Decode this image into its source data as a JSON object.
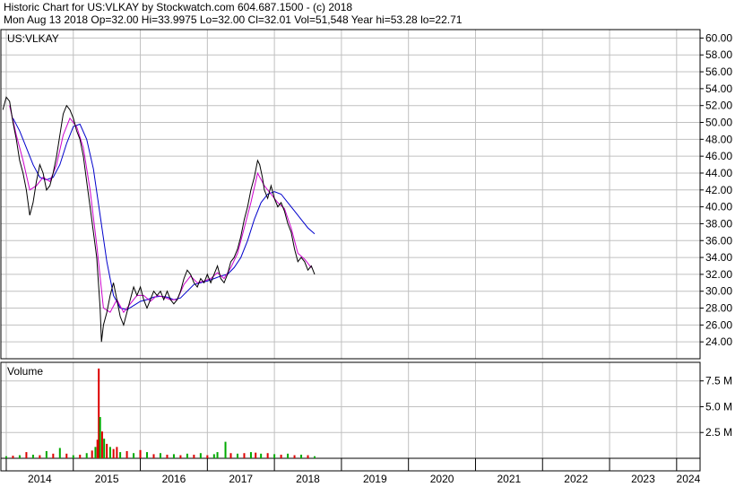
{
  "header": {
    "line1": "Historic Chart for US:VLKAY by Stockwatch.com 604.687.1500 - (c) 2018",
    "line2": "Mon Aug 13 2018  Op=32.00  Hi=33.9975  Lo=32.00  Cl=32.01  Vol=51,548  Year hi=53.28  lo=22.71"
  },
  "colors": {
    "price": "#000000",
    "ma_short": "#cc00cc",
    "ma_long": "#0000cc",
    "vol_up": "#00aa00",
    "vol_down": "#dd0000",
    "grid": "#c0c0c0"
  },
  "chart_data": [
    {
      "type": "line",
      "label": "US:VLKAY",
      "ylim": [
        22.0,
        61.0
      ],
      "y_ticks": [
        "60.00",
        "58.00",
        "56.00",
        "54.00",
        "52.00",
        "50.00",
        "48.00",
        "46.00",
        "44.00",
        "42.00",
        "40.00",
        "38.00",
        "36.00",
        "34.00",
        "32.00",
        "30.00",
        "28.00",
        "26.00",
        "24.00"
      ],
      "x_ticks": [
        "2014",
        "2015",
        "2016",
        "2017",
        "2018",
        "2019",
        "2020",
        "2021",
        "2022",
        "2023",
        "2024"
      ],
      "x_domain": [
        2013.92,
        2024.35
      ],
      "price_points": [
        [
          2013.95,
          51.5
        ],
        [
          2014.0,
          53.0
        ],
        [
          2014.05,
          52.5
        ],
        [
          2014.1,
          50.0
        ],
        [
          2014.15,
          48.0
        ],
        [
          2014.2,
          45.5
        ],
        [
          2014.25,
          44.0
        ],
        [
          2014.3,
          42.0
        ],
        [
          2014.35,
          39.0
        ],
        [
          2014.4,
          40.5
        ],
        [
          2014.45,
          43.0
        ],
        [
          2014.5,
          45.0
        ],
        [
          2014.55,
          44.0
        ],
        [
          2014.6,
          42.0
        ],
        [
          2014.65,
          42.5
        ],
        [
          2014.7,
          44.0
        ],
        [
          2014.75,
          46.0
        ],
        [
          2014.8,
          48.5
        ],
        [
          2014.85,
          51.0
        ],
        [
          2014.9,
          52.0
        ],
        [
          2014.95,
          51.5
        ],
        [
          2015.0,
          50.5
        ],
        [
          2015.05,
          49.0
        ],
        [
          2015.1,
          48.0
        ],
        [
          2015.15,
          46.0
        ],
        [
          2015.2,
          43.0
        ],
        [
          2015.25,
          40.0
        ],
        [
          2015.3,
          37.0
        ],
        [
          2015.35,
          34.0
        ],
        [
          2015.4,
          28.0
        ],
        [
          2015.42,
          24.0
        ],
        [
          2015.45,
          26.0
        ],
        [
          2015.5,
          27.5
        ],
        [
          2015.55,
          29.5
        ],
        [
          2015.6,
          31.0
        ],
        [
          2015.65,
          29.0
        ],
        [
          2015.7,
          27.0
        ],
        [
          2015.75,
          26.0
        ],
        [
          2015.8,
          27.5
        ],
        [
          2015.85,
          29.0
        ],
        [
          2015.9,
          30.5
        ],
        [
          2015.95,
          29.5
        ],
        [
          2016.0,
          30.5
        ],
        [
          2016.05,
          29.0
        ],
        [
          2016.1,
          28.0
        ],
        [
          2016.15,
          29.0
        ],
        [
          2016.2,
          30.0
        ],
        [
          2016.25,
          29.5
        ],
        [
          2016.3,
          30.0
        ],
        [
          2016.35,
          29.0
        ],
        [
          2016.4,
          30.0
        ],
        [
          2016.45,
          29.0
        ],
        [
          2016.5,
          28.5
        ],
        [
          2016.55,
          29.0
        ],
        [
          2016.6,
          30.0
        ],
        [
          2016.65,
          31.5
        ],
        [
          2016.7,
          32.5
        ],
        [
          2016.75,
          32.0
        ],
        [
          2016.8,
          31.0
        ],
        [
          2016.85,
          30.5
        ],
        [
          2016.9,
          31.5
        ],
        [
          2016.95,
          31.0
        ],
        [
          2017.0,
          32.0
        ],
        [
          2017.05,
          31.0
        ],
        [
          2017.1,
          32.0
        ],
        [
          2017.15,
          33.0
        ],
        [
          2017.2,
          31.5
        ],
        [
          2017.25,
          31.0
        ],
        [
          2017.3,
          32.0
        ],
        [
          2017.35,
          33.5
        ],
        [
          2017.4,
          34.0
        ],
        [
          2017.45,
          35.0
        ],
        [
          2017.5,
          36.5
        ],
        [
          2017.55,
          38.5
        ],
        [
          2017.6,
          40.0
        ],
        [
          2017.65,
          42.0
        ],
        [
          2017.7,
          43.5
        ],
        [
          2017.75,
          45.5
        ],
        [
          2017.78,
          45.0
        ],
        [
          2017.82,
          43.5
        ],
        [
          2017.85,
          42.0
        ],
        [
          2017.9,
          41.0
        ],
        [
          2017.95,
          42.5
        ],
        [
          2018.0,
          41.0
        ],
        [
          2018.05,
          40.0
        ],
        [
          2018.1,
          40.5
        ],
        [
          2018.15,
          39.5
        ],
        [
          2018.2,
          38.0
        ],
        [
          2018.25,
          37.0
        ],
        [
          2018.3,
          35.0
        ],
        [
          2018.35,
          33.5
        ],
        [
          2018.4,
          34.0
        ],
        [
          2018.45,
          33.5
        ],
        [
          2018.5,
          32.5
        ],
        [
          2018.55,
          33.0
        ],
        [
          2018.6,
          32.0
        ]
      ],
      "ma_short_points": [
        [
          2014.05,
          52.0
        ],
        [
          2014.15,
          48.5
        ],
        [
          2014.25,
          45.5
        ],
        [
          2014.35,
          42.0
        ],
        [
          2014.45,
          42.5
        ],
        [
          2014.55,
          43.5
        ],
        [
          2014.65,
          43.0
        ],
        [
          2014.75,
          45.0
        ],
        [
          2014.85,
          48.5
        ],
        [
          2014.95,
          50.5
        ],
        [
          2015.05,
          49.5
        ],
        [
          2015.15,
          47.0
        ],
        [
          2015.25,
          42.0
        ],
        [
          2015.35,
          35.5
        ],
        [
          2015.45,
          28.0
        ],
        [
          2015.55,
          27.5
        ],
        [
          2015.65,
          29.0
        ],
        [
          2015.75,
          27.5
        ],
        [
          2015.85,
          28.5
        ],
        [
          2015.95,
          29.5
        ],
        [
          2016.05,
          29.5
        ],
        [
          2016.15,
          28.8
        ],
        [
          2016.25,
          29.5
        ],
        [
          2016.35,
          29.3
        ],
        [
          2016.45,
          29.0
        ],
        [
          2016.55,
          29.0
        ],
        [
          2016.65,
          30.8
        ],
        [
          2016.75,
          31.8
        ],
        [
          2016.85,
          31.0
        ],
        [
          2016.95,
          31.2
        ],
        [
          2017.05,
          31.5
        ],
        [
          2017.15,
          32.2
        ],
        [
          2017.25,
          31.5
        ],
        [
          2017.35,
          32.8
        ],
        [
          2017.45,
          34.5
        ],
        [
          2017.55,
          37.5
        ],
        [
          2017.65,
          40.5
        ],
        [
          2017.75,
          44.0
        ],
        [
          2017.85,
          42.5
        ],
        [
          2017.95,
          41.5
        ],
        [
          2018.05,
          40.5
        ],
        [
          2018.15,
          39.8
        ],
        [
          2018.25,
          37.5
        ],
        [
          2018.35,
          34.5
        ],
        [
          2018.45,
          33.8
        ],
        [
          2018.55,
          32.8
        ]
      ],
      "ma_long_points": [
        [
          2014.1,
          50.5
        ],
        [
          2014.2,
          49.0
        ],
        [
          2014.3,
          47.0
        ],
        [
          2014.4,
          45.0
        ],
        [
          2014.5,
          43.5
        ],
        [
          2014.6,
          43.2
        ],
        [
          2014.7,
          43.5
        ],
        [
          2014.8,
          45.0
        ],
        [
          2014.9,
          47.5
        ],
        [
          2015.0,
          49.5
        ],
        [
          2015.1,
          49.8
        ],
        [
          2015.2,
          48.0
        ],
        [
          2015.3,
          44.5
        ],
        [
          2015.4,
          39.0
        ],
        [
          2015.5,
          33.5
        ],
        [
          2015.6,
          29.5
        ],
        [
          2015.7,
          28.0
        ],
        [
          2015.8,
          27.8
        ],
        [
          2015.9,
          28.3
        ],
        [
          2016.0,
          28.8
        ],
        [
          2016.1,
          29.0
        ],
        [
          2016.2,
          29.3
        ],
        [
          2016.3,
          29.4
        ],
        [
          2016.4,
          29.3
        ],
        [
          2016.5,
          29.0
        ],
        [
          2016.6,
          29.2
        ],
        [
          2016.7,
          30.0
        ],
        [
          2016.8,
          30.8
        ],
        [
          2016.9,
          31.0
        ],
        [
          2017.0,
          31.2
        ],
        [
          2017.1,
          31.5
        ],
        [
          2017.2,
          31.8
        ],
        [
          2017.3,
          32.0
        ],
        [
          2017.4,
          32.8
        ],
        [
          2017.5,
          34.0
        ],
        [
          2017.6,
          36.0
        ],
        [
          2017.7,
          38.5
        ],
        [
          2017.8,
          40.5
        ],
        [
          2017.9,
          41.5
        ],
        [
          2018.0,
          41.8
        ],
        [
          2018.1,
          41.5
        ],
        [
          2018.2,
          40.5
        ],
        [
          2018.3,
          39.5
        ],
        [
          2018.4,
          38.5
        ],
        [
          2018.5,
          37.5
        ],
        [
          2018.6,
          36.8
        ]
      ]
    },
    {
      "type": "bar",
      "label": "Volume",
      "ylim": [
        0,
        9.3
      ],
      "y_ticks": [
        "7.5 M",
        "5.0 M",
        "2.5 M"
      ],
      "bars": [
        [
          2014.0,
          0.2,
          "up"
        ],
        [
          2014.1,
          0.25,
          "down"
        ],
        [
          2014.2,
          0.3,
          "up"
        ],
        [
          2014.3,
          0.6,
          "down"
        ],
        [
          2014.4,
          0.35,
          "up"
        ],
        [
          2014.5,
          0.3,
          "down"
        ],
        [
          2014.6,
          0.7,
          "up"
        ],
        [
          2014.7,
          0.45,
          "down"
        ],
        [
          2014.8,
          1.0,
          "up"
        ],
        [
          2014.9,
          0.45,
          "down"
        ],
        [
          2015.0,
          0.3,
          "up"
        ],
        [
          2015.1,
          0.35,
          "down"
        ],
        [
          2015.2,
          0.5,
          "up"
        ],
        [
          2015.28,
          0.75,
          "down"
        ],
        [
          2015.33,
          1.1,
          "up"
        ],
        [
          2015.36,
          1.8,
          "down"
        ],
        [
          2015.38,
          8.7,
          "down"
        ],
        [
          2015.4,
          4.0,
          "up"
        ],
        [
          2015.43,
          2.6,
          "down"
        ],
        [
          2015.46,
          1.9,
          "up"
        ],
        [
          2015.5,
          1.4,
          "down"
        ],
        [
          2015.55,
          1.1,
          "up"
        ],
        [
          2015.6,
          0.9,
          "down"
        ],
        [
          2015.65,
          1.1,
          "down"
        ],
        [
          2015.7,
          0.6,
          "up"
        ],
        [
          2015.8,
          0.7,
          "down"
        ],
        [
          2015.9,
          0.5,
          "up"
        ],
        [
          2016.0,
          0.8,
          "down"
        ],
        [
          2016.1,
          0.6,
          "up"
        ],
        [
          2016.2,
          0.4,
          "down"
        ],
        [
          2016.3,
          0.5,
          "up"
        ],
        [
          2016.4,
          0.35,
          "down"
        ],
        [
          2016.5,
          0.4,
          "up"
        ],
        [
          2016.6,
          0.3,
          "down"
        ],
        [
          2016.7,
          0.45,
          "up"
        ],
        [
          2016.8,
          0.35,
          "down"
        ],
        [
          2016.9,
          0.5,
          "up"
        ],
        [
          2017.0,
          0.3,
          "down"
        ],
        [
          2017.1,
          0.4,
          "up"
        ],
        [
          2017.15,
          0.6,
          "up"
        ],
        [
          2017.27,
          1.6,
          "up"
        ],
        [
          2017.35,
          0.5,
          "down"
        ],
        [
          2017.45,
          0.45,
          "up"
        ],
        [
          2017.55,
          0.5,
          "down"
        ],
        [
          2017.65,
          0.6,
          "up"
        ],
        [
          2017.72,
          0.55,
          "down"
        ],
        [
          2017.8,
          0.45,
          "up"
        ],
        [
          2017.9,
          0.5,
          "down"
        ],
        [
          2018.0,
          0.4,
          "up"
        ],
        [
          2018.1,
          0.35,
          "down"
        ],
        [
          2018.2,
          0.45,
          "up"
        ],
        [
          2018.3,
          0.3,
          "down"
        ],
        [
          2018.4,
          0.35,
          "up"
        ],
        [
          2018.5,
          0.3,
          "down"
        ],
        [
          2018.6,
          0.2,
          "up"
        ]
      ]
    }
  ]
}
